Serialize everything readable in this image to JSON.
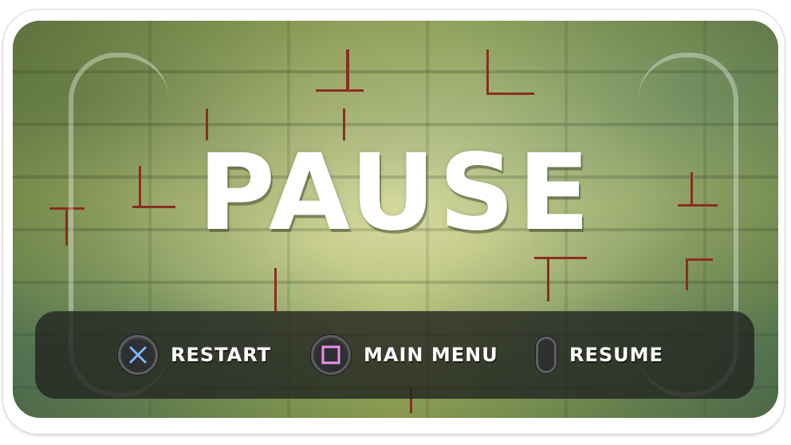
{
  "pause_menu": {
    "title": "PAUSE",
    "actions": [
      {
        "button_icon": "cross-button-icon",
        "label": "RESTART",
        "icon_color": "#7fb6ff"
      },
      {
        "button_icon": "square-button-icon",
        "label": "MAIN MENU",
        "icon_color": "#f08cf0"
      },
      {
        "button_icon": "options-button-icon",
        "label": "RESUME"
      }
    ]
  },
  "colors": {
    "bar_background": "#23261f",
    "text": "#ffffff",
    "button_ring": "#5d5f63"
  }
}
